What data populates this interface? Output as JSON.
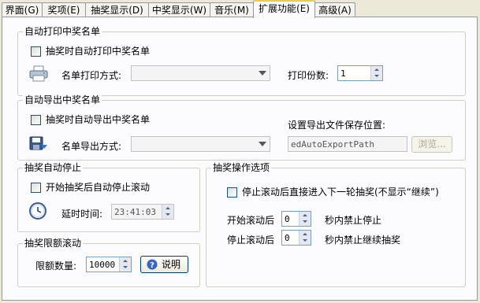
{
  "tabs": [
    {
      "label": "界面(G)"
    },
    {
      "label": "奖项(E)"
    },
    {
      "label": "抽奖显示(D)"
    },
    {
      "label": "中奖显示(W)"
    },
    {
      "label": "音乐(M)"
    },
    {
      "label": "扩展功能(E)"
    },
    {
      "label": "高级(A)"
    }
  ],
  "active_tab": "扩展功能(E)",
  "print_group": {
    "title": "自动打印中奖名单",
    "checkbox_label": "抽奖时自动打印中奖名单",
    "checked": false,
    "method_label": "名单打印方式:",
    "method_value": "",
    "copies_label": "打印份数:",
    "copies_value": "1",
    "icon": "printer-icon"
  },
  "export_group": {
    "title": "自动导出中奖名单",
    "checkbox_label": "抽奖时自动导出中奖名单",
    "checked": false,
    "method_label": "名单导出方式:",
    "method_value": "",
    "path_label": "设置导出文件保存位置:",
    "path_value": "edAutoExportPath",
    "browse_label": "浏览...",
    "icon": "save-icon"
  },
  "autostop_group": {
    "title": "抽奖自动停止",
    "checkbox_label": "开始抽奖后自动停止滚动",
    "checked": false,
    "delay_label": "延时时间:",
    "delay_value": "23:41:03",
    "icon": "clock-icon"
  },
  "limit_group": {
    "title": "抽奖限额滚动",
    "quantity_label": "限额数量:",
    "quantity_value": "10000",
    "help_label": "说明",
    "icon": "help-icon"
  },
  "ops_group": {
    "title": "抽奖操作选项",
    "checkbox_label": "停止滚动后直接进入下一轮抽奖(不显示“继续”)",
    "checked": false,
    "start_prefix": "开始滚动后",
    "start_value": "0",
    "start_suffix": "秒内禁止停止",
    "stop_prefix": "停止滚动后",
    "stop_value": "0",
    "stop_suffix": "秒内禁止继续抽奖"
  }
}
